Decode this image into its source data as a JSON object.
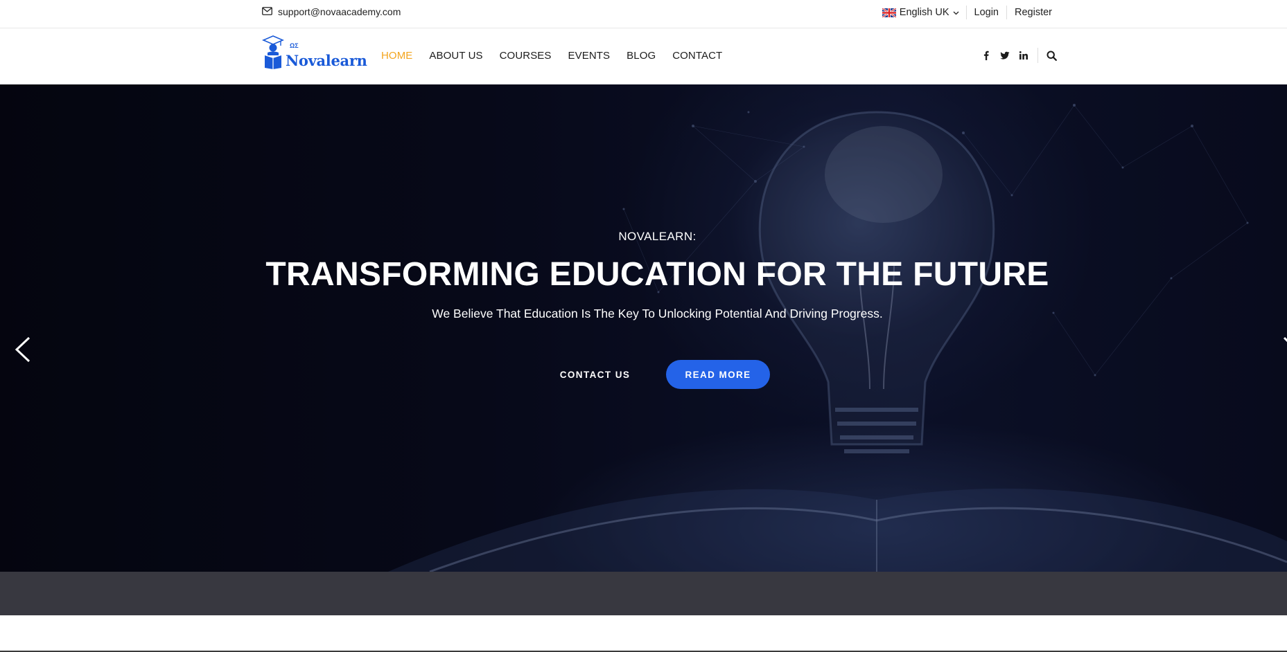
{
  "topbar": {
    "email": "support@novaacademy.com",
    "language": "English UK",
    "login_label": "Login",
    "register_label": "Register"
  },
  "logo": {
    "brand": "Novalearn",
    "small_text": "ΩΣ"
  },
  "nav": {
    "items": [
      {
        "label": "HOME",
        "active": true
      },
      {
        "label": "ABOUT US"
      },
      {
        "label": "COURSES"
      },
      {
        "label": "EVENTS"
      },
      {
        "label": "BLOG"
      },
      {
        "label": "CONTACT"
      }
    ],
    "social_icons": [
      "facebook-icon",
      "twitter-icon",
      "linkedin-icon"
    ],
    "search_icon": "search-icon"
  },
  "hero": {
    "kicker": "NOVALEARN:",
    "headline": "TRANSFORMING EDUCATION FOR THE FUTURE",
    "subheadline": "We Believe That Education Is The Key To Unlocking Potential And Driving Progress.",
    "contact_button": "CONTACT US",
    "read_more_button": "READ MORE"
  },
  "colors": {
    "accent_active_nav": "#f3a51e",
    "brand_blue": "#1a5ad8",
    "button_blue": "#2463e8",
    "band": "#383840"
  }
}
